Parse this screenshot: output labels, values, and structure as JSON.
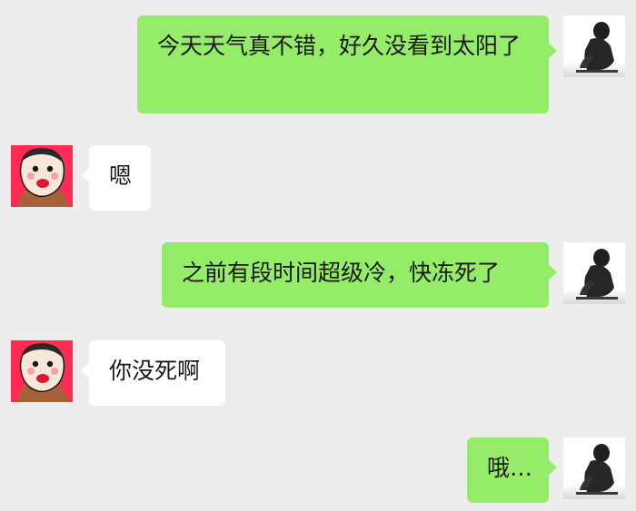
{
  "colors": {
    "background": "#ededed",
    "sent_bubble": "#95ec69",
    "received_bubble": "#ffffff",
    "text": "#191919",
    "friend_avatar_bg": "#ff2b52"
  },
  "avatars": {
    "me": "silhouette-avatar",
    "friend": "cartoon-face-avatar"
  },
  "messages": [
    {
      "sender": "me",
      "text": "今天天气真不错，好久没看到太阳了"
    },
    {
      "sender": "friend",
      "text": "嗯"
    },
    {
      "sender": "me",
      "text": "之前有段时间超级冷，快冻死了"
    },
    {
      "sender": "friend",
      "text": "你没死啊"
    },
    {
      "sender": "me",
      "text": "哦…"
    }
  ]
}
